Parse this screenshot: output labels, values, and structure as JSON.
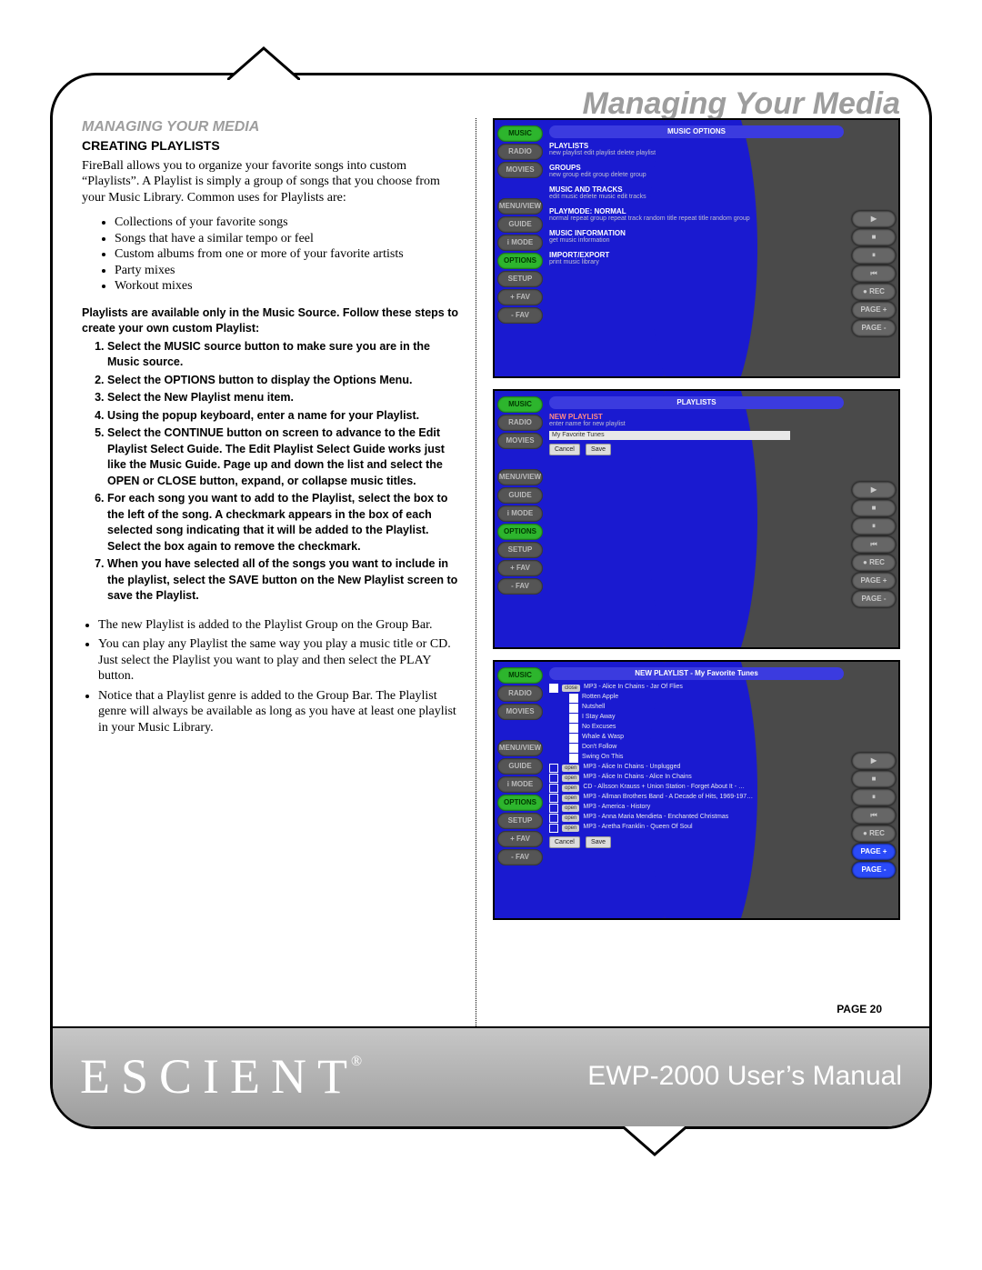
{
  "chapter_title": "Managing Your Media",
  "section_header": "MANAGING YOUR MEDIA",
  "subsection": "CREATING PLAYLISTS",
  "intro_para": "FireBall allows you to organize your favorite songs into custom “Playlists”. A Playlist is simply a group of songs that you choose from your Music Library. Common uses for Playlists are:",
  "bullets": [
    "Collections of your favorite songs",
    "Songs that have a similar tempo or feel",
    "Custom albums from one or more of your favorite artists",
    "Party mixes",
    "Workout mixes"
  ],
  "steps_intro": "Playlists are available only in the Music Source. Follow these steps to create your own custom Playlist:",
  "steps": [
    "Select the MUSIC source button to make sure you are in the Music source.",
    "Select the OPTIONS button to display the Options Menu.",
    "Select the New Playlist menu item.",
    "Using the popup keyboard, enter a name for your Playlist.",
    "Select the CONTINUE button on screen to advance to the Edit Playlist Select Guide. The Edit Playlist Select Guide works just like the Music Guide. Page up and down the list and select the OPEN or CLOSE button, expand, or collapse music titles.",
    "For each song you want to add to the Playlist, select the box to the left of the song. A checkmark appears in the box of each selected song indicating that it will be added to the Playlist. Select the box again to remove the checkmark.",
    "When you have selected all of the songs you want to include in the playlist, select the SAVE button on the New Playlist screen to save the Playlist."
  ],
  "notes": [
    "The new Playlist is added to the Playlist Group on the Group Bar.",
    "You can play any Playlist the same way you play a music title or CD. Just select the Playlist you want to play and then select the PLAY button.",
    "Notice that a Playlist genre is added to the Group Bar. The Playlist genre will always be available as long as you have at least one playlist in your Music Library."
  ],
  "page_label": "PAGE 20",
  "footer": {
    "logo": "ESCIENT",
    "manual": "EWP-2000 User’s Manual"
  },
  "side_buttons": [
    "MUSIC",
    "RADIO",
    "MOVIES",
    "",
    "MENU/VIEW",
    "GUIDE",
    "i MODE",
    "OPTIONS",
    "SETUP",
    "+ FAV",
    "- FAV"
  ],
  "right_buttons_std": [
    "▶",
    "■",
    "⏸",
    "⏮",
    "● REC",
    "PAGE +",
    "PAGE -"
  ],
  "shot1": {
    "title": "MUSIC OPTIONS",
    "groups": [
      {
        "t": "PLAYLISTS",
        "s": "new playlist  edit playlist  delete playlist"
      },
      {
        "t": "GROUPS",
        "s": "new group  edit group  delete group"
      },
      {
        "t": "MUSIC AND TRACKS",
        "s": "edit music  delete music  edit tracks"
      },
      {
        "t": "PLAYMODE: NORMAL",
        "s": "normal  repeat group  repeat track  random title  repeat title  random group"
      },
      {
        "t": "MUSIC INFORMATION",
        "s": "get music information"
      },
      {
        "t": "IMPORT/EXPORT",
        "s": "print music library"
      }
    ]
  },
  "shot2": {
    "title": "PLAYLISTS",
    "subtitle": "NEW PLAYLIST",
    "prompt": "enter name for new playlist",
    "input_value": "My Favorite Tunes",
    "btn_cancel": "Cancel",
    "btn_save": "Save"
  },
  "shot3": {
    "title": "NEW PLAYLIST - My Favorite Tunes",
    "album_open": "MP3 - Alice In Chains - Jar Of Flies",
    "tracks": [
      {
        "on": true,
        "t": "Rotten Apple"
      },
      {
        "on": true,
        "t": "Nutshell"
      },
      {
        "on": true,
        "t": "I Stay Away"
      },
      {
        "on": true,
        "t": "No Excuses"
      },
      {
        "on": true,
        "t": "Whale & Wasp"
      },
      {
        "on": true,
        "t": "Don't Follow"
      },
      {
        "on": true,
        "t": "Swing On This"
      }
    ],
    "albums": [
      "MP3 - Alice In Chains - Unplugged",
      "MP3 - Alice In Chains - Alice In Chains",
      "CD - Allsson Krauss + Union Station - Forget About It - …",
      "MP3 - Allman Brothers Band - A Decade of Hits, 1969-197…",
      "MP3 - America - History",
      "MP3 - Anna Maria Mendieta - Enchanted Christmas",
      "MP3 - Aretha Franklin - Queen Of Soul"
    ],
    "btn_open": "open",
    "btn_close": "close",
    "btn_cancel": "Cancel",
    "btn_save": "Save"
  }
}
